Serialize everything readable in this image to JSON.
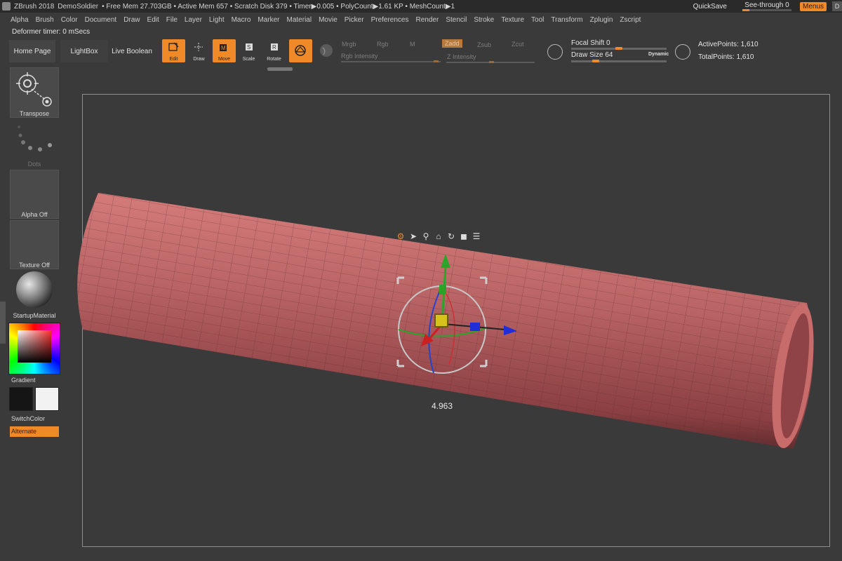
{
  "titlebar": {
    "app": "ZBrush 2018",
    "project": "DemoSoldier",
    "stats": "• Free Mem 27.703GB • Active Mem 657 • Scratch Disk 379 • Timer▶0.005 • PolyCount▶1.61 KP • MeshCount▶1",
    "quicksave": "QuickSave",
    "seethrough": "See-through  0",
    "menus": "Menus",
    "d_label": "D"
  },
  "menubar": [
    "Alpha",
    "Brush",
    "Color",
    "Document",
    "Draw",
    "Edit",
    "File",
    "Layer",
    "Light",
    "Macro",
    "Marker",
    "Material",
    "Movie",
    "Picker",
    "Preferences",
    "Render",
    "Stencil",
    "Stroke",
    "Texture",
    "Tool",
    "Transform",
    "Zplugin",
    "Zscript"
  ],
  "deformer": "Deformer timer: 0 mSecs",
  "toolbar": {
    "home": "Home Page",
    "lightbox": "LightBox",
    "liveboolean": "Live Boolean",
    "edit": "Edit",
    "draw": "Draw",
    "move": "Move",
    "scale": "Scale",
    "rotate": "Rotate",
    "mrgb": "Mrgb",
    "rgb": "Rgb",
    "m": "M",
    "zadd": "Zadd",
    "zsub": "Zsub",
    "zcut": "Zcut",
    "rgb_intensity": "Rgb Intensity",
    "z_intensity": "Z Intensity",
    "focal_shift": "Focal Shift 0",
    "draw_size": "Draw Size 64",
    "dynamic": "Dynamic",
    "active_points": "ActivePoints: 1,610",
    "total_points": "TotalPoints: 1,610"
  },
  "shelf": {
    "transpose": "Transpose",
    "dots": "Dots",
    "alpha_off": "Alpha Off",
    "texture_off": "Texture Off",
    "material": "StartupMaterial",
    "gradient": "Gradient",
    "switchcolor": "SwitchColor",
    "alternate": "Alternate"
  },
  "viewport": {
    "measurement": "4.963"
  },
  "colors": {
    "accent": "#f08a28",
    "mesh": "#b85d5f",
    "background": "#3a3a3a"
  }
}
